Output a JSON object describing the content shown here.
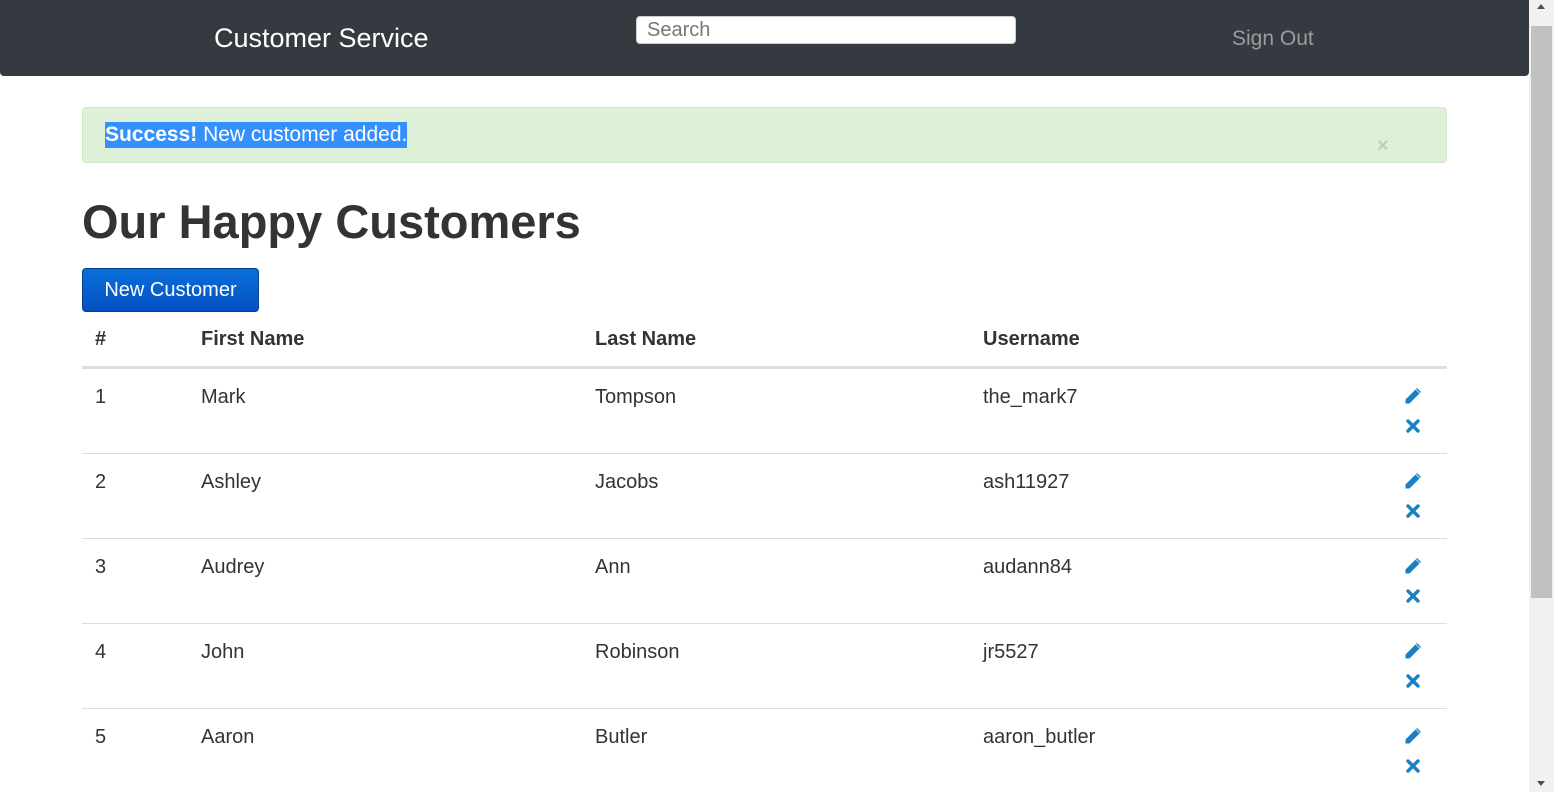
{
  "navbar": {
    "brand": "Customer Service",
    "search_placeholder": "Search",
    "signout_label": "Sign Out"
  },
  "alert": {
    "strong": "Success!",
    "message": " New customer added.",
    "close_symbol": "×"
  },
  "page_title": "Our Happy Customers",
  "new_customer_label": "New Customer",
  "table": {
    "headers": [
      "#",
      "First Name",
      "Last Name",
      "Username"
    ],
    "rows": [
      {
        "num": "1",
        "first": "Mark",
        "last": "Tompson",
        "username": "the_mark7"
      },
      {
        "num": "2",
        "first": "Ashley",
        "last": "Jacobs",
        "username": "ash11927"
      },
      {
        "num": "3",
        "first": "Audrey",
        "last": "Ann",
        "username": "audann84"
      },
      {
        "num": "4",
        "first": "John",
        "last": "Robinson",
        "username": "jr5527"
      },
      {
        "num": "5",
        "first": "Aaron",
        "last": "Butler",
        "username": "aaron_butler"
      }
    ],
    "row_actions": {
      "edit_icon": "pencil-icon",
      "delete_icon": "close-icon"
    }
  },
  "colors": {
    "navbar": "#343a40",
    "alert_background": "#dff0d8",
    "primary_button": "#0a6fdc",
    "action_icon": "#1a80c4"
  }
}
